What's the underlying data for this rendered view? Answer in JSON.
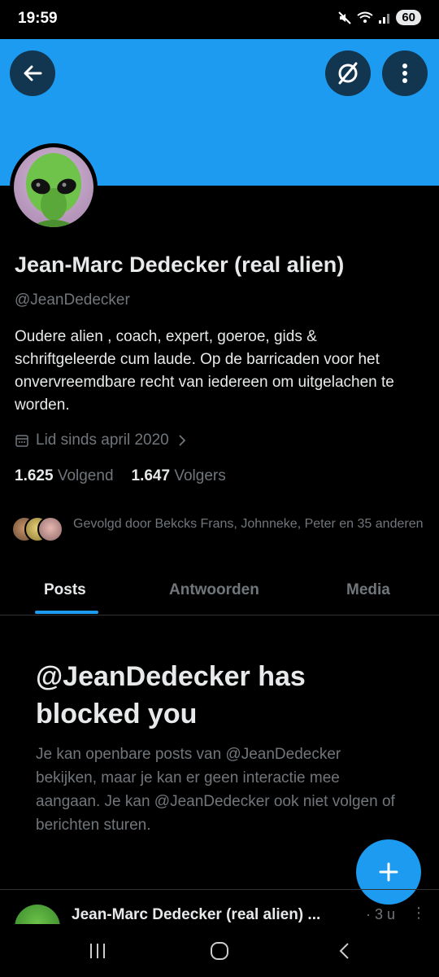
{
  "status_bar": {
    "time": "19:59",
    "battery": "60"
  },
  "colors": {
    "accent": "#1d9bf0",
    "background": "#000000",
    "text": "#e7e9ea",
    "muted": "#71767b"
  },
  "icons": [
    "arrow-left-icon",
    "noun-disabled-icon",
    "more-vertical-icon",
    "calendar-icon",
    "chevron-right-icon",
    "plus-icon"
  ],
  "profile": {
    "name": "Jean-Marc Dedecker (real alien)",
    "handle": "@JeanDedecker",
    "bio": "Oudere alien , coach, expert, goeroe, gids  & schriftgeleerde cum laude.  Op de barricaden voor het onvervreemdbare recht van iedereen om uitgelachen te worden.",
    "joined": "Lid sinds april 2020",
    "following_count": "1.625",
    "following_label": "Volgend",
    "followers_count": "1.647",
    "followers_label": "Volgers",
    "followed_by": "Gevolgd door Bekcks Frans, Johnneke, Peter en 35 anderen"
  },
  "tabs": [
    {
      "label": "Posts"
    },
    {
      "label": "Antwoorden"
    },
    {
      "label": "Media"
    }
  ],
  "blocked": {
    "title": "@JeanDedecker has blocked you",
    "body": "Je kan openbare posts van @JeanDedecker bekijken, maar je kan er geen interactie mee aangaan. Je kan @JeanDedecker ook niet volgen of berichten sturen."
  },
  "post": {
    "author": "Jean-Marc Dedecker (real alien) ...",
    "time": "· 3 u"
  }
}
